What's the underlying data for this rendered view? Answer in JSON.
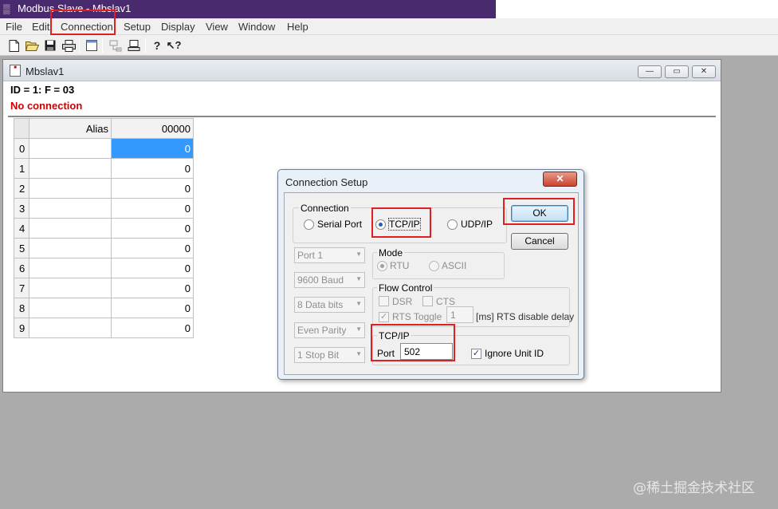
{
  "app": {
    "title": "Modbus Slave - Mbslav1"
  },
  "menu": [
    "File",
    "Edit",
    "Connection",
    "Setup",
    "Display",
    "View",
    "Window",
    "Help"
  ],
  "child": {
    "title": "Mbslav1",
    "id_line": "ID = 1: F = 03",
    "status": "No connection",
    "grid": {
      "headers": [
        "Alias",
        "00000"
      ],
      "rows": [
        {
          "index": "0",
          "alias": "",
          "value": "0"
        },
        {
          "index": "1",
          "alias": "",
          "value": "0"
        },
        {
          "index": "2",
          "alias": "",
          "value": "0"
        },
        {
          "index": "3",
          "alias": "",
          "value": "0"
        },
        {
          "index": "4",
          "alias": "",
          "value": "0"
        },
        {
          "index": "5",
          "alias": "",
          "value": "0"
        },
        {
          "index": "6",
          "alias": "",
          "value": "0"
        },
        {
          "index": "7",
          "alias": "",
          "value": "0"
        },
        {
          "index": "8",
          "alias": "",
          "value": "0"
        },
        {
          "index": "9",
          "alias": "",
          "value": "0"
        }
      ]
    }
  },
  "dialog": {
    "title": "Connection Setup",
    "close": "✕",
    "connection_group": "Connection",
    "serial_port": "Serial Port",
    "tcp_ip": "TCP/IP",
    "udp_ip": "UDP/IP",
    "ok": "OK",
    "cancel": "Cancel",
    "port_combo": "Port 1",
    "baud_combo": "9600 Baud",
    "data_bits_combo": "8 Data bits",
    "parity_combo": "Even Parity",
    "stop_bit_combo": "1 Stop Bit",
    "mode_group": "Mode",
    "rtu": "RTU",
    "ascii": "ASCII",
    "flow_group": "Flow Control",
    "dsr": "DSR",
    "cts": "CTS",
    "rts_toggle": "RTS Toggle",
    "rts_delay_value": "1",
    "rts_delay_label": "[ms] RTS disable delay",
    "tcpip_group": "TCP/IP",
    "port_label": "Port",
    "port_value": "502",
    "ignore_unit_id": "Ignore Unit ID"
  },
  "watermark": "@稀土掘金技术社区"
}
